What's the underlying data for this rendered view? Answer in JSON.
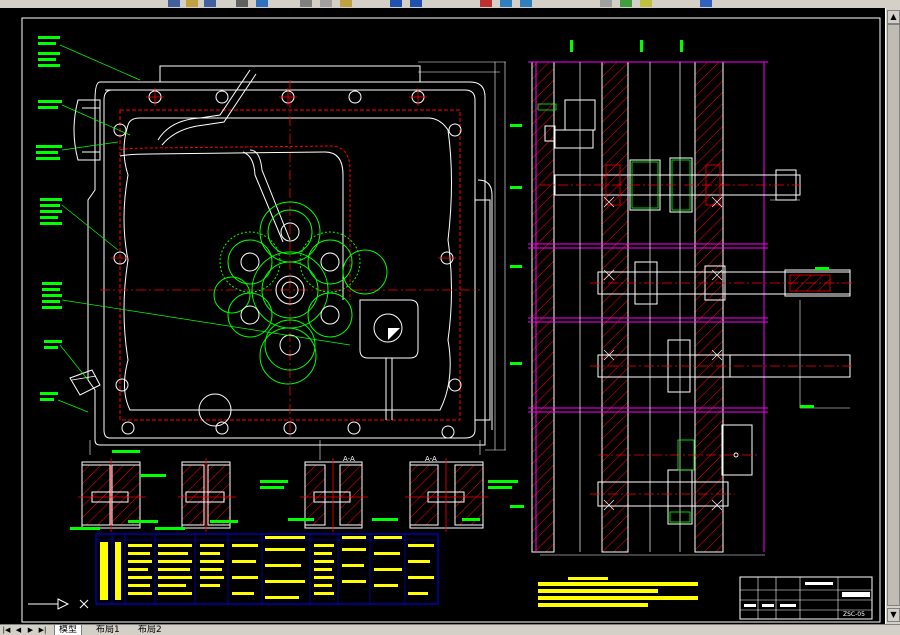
{
  "tabs": [
    {
      "label": "模型"
    },
    {
      "label": "布局1"
    },
    {
      "label": "布局2"
    }
  ],
  "drawing": {
    "section_label_1": "A-A",
    "section_label_2": "A-A",
    "title_block_code": "ZSC-05"
  },
  "colors": {
    "background": "#000000",
    "outline": "#ffffff",
    "center": "#ff0000",
    "gear": "#00ff00",
    "hatch": "#ff0000",
    "layer_magenta": "#ff00ff",
    "annotation": "#00ff00",
    "table_fill": "#ffff00",
    "table_grid": "#0000ff"
  }
}
